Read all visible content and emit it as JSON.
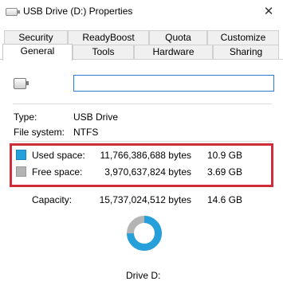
{
  "window": {
    "title": "USB Drive (D:) Properties",
    "close": "✕"
  },
  "tabs": {
    "row1": [
      "Security",
      "ReadyBoost",
      "Quota",
      "Customize"
    ],
    "row2": [
      "General",
      "Tools",
      "Hardware",
      "Sharing"
    ],
    "active": "General"
  },
  "general": {
    "drive_name_value": "",
    "type_label": "Type:",
    "type_value": "USB Drive",
    "fs_label": "File system:",
    "fs_value": "NTFS",
    "used": {
      "label": "Used space:",
      "bytes": "11,766,386,688 bytes",
      "size": "10.9 GB"
    },
    "free": {
      "label": "Free space:",
      "bytes": "3,970,637,824 bytes",
      "size": "3.69 GB"
    },
    "capacity": {
      "label": "Capacity:",
      "bytes": "15,737,024,512 bytes",
      "size": "14.6 GB"
    },
    "drive_label": "Drive D:"
  },
  "colors": {
    "used": "#26a0da",
    "free": "#b4b4b4",
    "highlight": "#cf2d3a"
  },
  "chart_data": {
    "type": "pie",
    "categories": [
      "Used space",
      "Free space"
    ],
    "values": [
      11766386688,
      3970637824
    ]
  }
}
